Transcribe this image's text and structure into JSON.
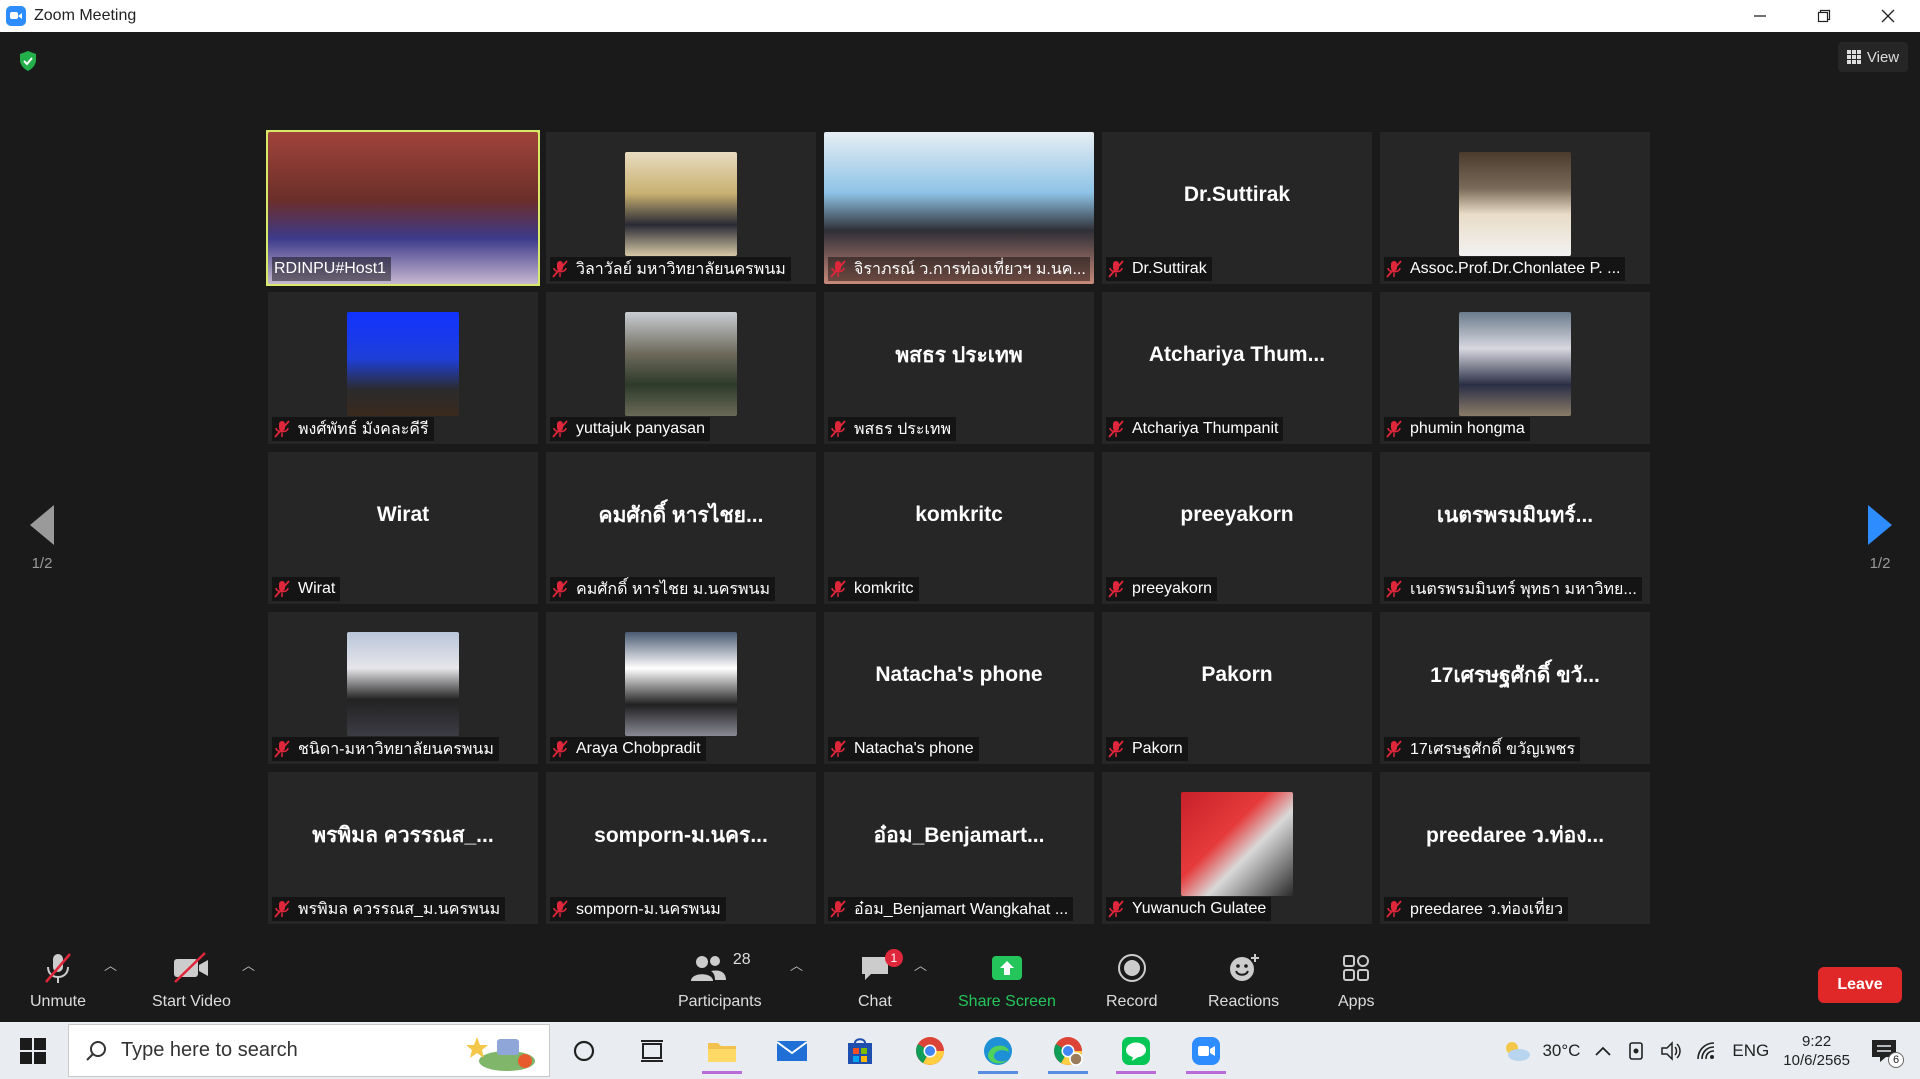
{
  "window": {
    "title": "Zoom Meeting"
  },
  "header": {
    "view_label": "View"
  },
  "pagination": {
    "left": "1/2",
    "right": "1/2"
  },
  "tiles": [
    {
      "label": "RDINPU#Host1",
      "center": "",
      "video": "v1",
      "wide": false,
      "active": true,
      "muted": false
    },
    {
      "label": "วิลาวัลย์ มหาวิทยาลัยนครพนม",
      "center": "",
      "video": "v2",
      "muted": true
    },
    {
      "label": "จิราภรณ์ ว.การท่องเที่ยวฯ ม.นค...",
      "center": "",
      "video": "v3",
      "wide": true,
      "muted": true
    },
    {
      "label": "Dr.Suttirak",
      "center": "Dr.Suttirak",
      "video": "",
      "muted": true
    },
    {
      "label": "Assoc.Prof.Dr.Chonlatee P. ...",
      "center": "",
      "video": "v4",
      "muted": true
    },
    {
      "label": "พงศ์พัทธ์ มังคละคีรี",
      "center": "",
      "video": "v5",
      "muted": true
    },
    {
      "label": "yuttajuk panyasan",
      "center": "",
      "video": "v6",
      "muted": true
    },
    {
      "label": "พสธร ประเทพ",
      "center": "พสธร ประเทพ",
      "video": "",
      "muted": true
    },
    {
      "label": "Atchariya Thumpanit",
      "center": "Atchariya Thum...",
      "video": "",
      "muted": true
    },
    {
      "label": "phumin hongma",
      "center": "",
      "video": "v7",
      "muted": true
    },
    {
      "label": "Wirat",
      "center": "Wirat",
      "video": "",
      "muted": true
    },
    {
      "label": "คมศักดิ์ หารไชย ม.นครพนม",
      "center": "คมศักดิ์ หารไชย...",
      "video": "",
      "muted": true
    },
    {
      "label": "komkritc",
      "center": "komkritc",
      "video": "",
      "muted": true
    },
    {
      "label": "preeyakorn",
      "center": "preeyakorn",
      "video": "",
      "muted": true
    },
    {
      "label": "เนตรพรมมินทร์ พุทธา มหาวิทย...",
      "center": "เนตรพรมมินทร์...",
      "video": "",
      "muted": true
    },
    {
      "label": "ชนิดา-มหาวิทยาลัยนครพนม",
      "center": "",
      "video": "v8",
      "muted": true
    },
    {
      "label": "Araya Chobpradit",
      "center": "",
      "video": "v9",
      "muted": true
    },
    {
      "label": "Natacha's phone",
      "center": "Natacha's phone",
      "video": "",
      "muted": true
    },
    {
      "label": "Pakorn",
      "center": "Pakorn",
      "video": "",
      "muted": true
    },
    {
      "label": "17เศรษฐศักดิ์ ขวัญเพชร",
      "center": "17เศรษฐศักดิ์ ขวั...",
      "video": "",
      "muted": true
    },
    {
      "label": "พรพิมล ควรรณส_ม.นครพนม",
      "center": "พรพิมล ควรรณส_...",
      "video": "",
      "muted": true
    },
    {
      "label": "somporn-ม.นครพนม",
      "center": "somporn-ม.นคร...",
      "video": "",
      "muted": true
    },
    {
      "label": "อ๋อม_Benjamart Wangkahat ...",
      "center": "อ๋อม_Benjamart...",
      "video": "",
      "muted": true
    },
    {
      "label": "Yuwanuch Gulatee",
      "center": "",
      "video": "v10",
      "muted": true
    },
    {
      "label": "preedaree ว.ท่องเที่ยว",
      "center": "preedaree ว.ท่อง...",
      "video": "",
      "muted": true
    }
  ],
  "toolbar": {
    "unmute": "Unmute",
    "start_video": "Start Video",
    "participants": "Participants",
    "participants_count": "28",
    "chat": "Chat",
    "chat_badge": "1",
    "share_screen": "Share Screen",
    "record": "Record",
    "reactions": "Reactions",
    "apps": "Apps",
    "leave": "Leave"
  },
  "taskbar": {
    "search_placeholder": "Type here to search",
    "weather": "30°C",
    "language": "ENG",
    "time": "9:22",
    "date": "10/6/2565",
    "notifications": "6"
  },
  "colors": {
    "accent": "#2d8cff",
    "active_border": "#d8e86a",
    "leave": "#e02828",
    "share": "#24c55b",
    "muted_icon": "#e0263a"
  }
}
